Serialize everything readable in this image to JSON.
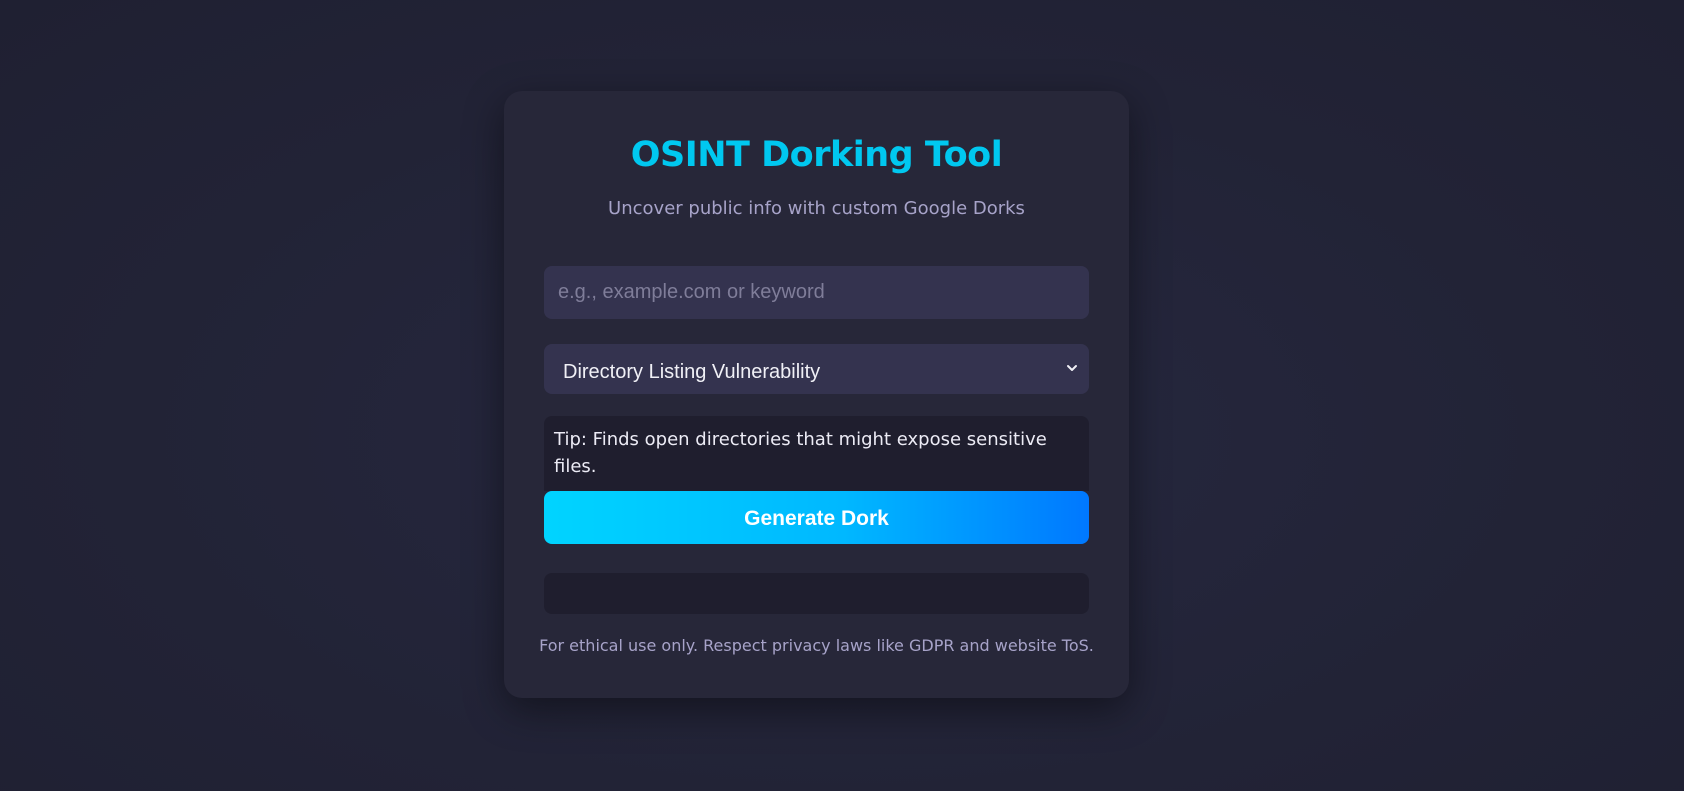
{
  "header": {
    "title": "OSINT Dorking Tool",
    "subtitle": "Uncover public info with custom Google Dorks"
  },
  "search": {
    "value": "",
    "placeholder": "e.g., example.com or keyword"
  },
  "dork_type": {
    "selected": "Directory Listing Vulnerability",
    "icon": "chevron-down-icon"
  },
  "tip": {
    "text": "Tip: Finds open directories that might expose sensitive files."
  },
  "actions": {
    "generate_label": "Generate Dork"
  },
  "output": {
    "text": ""
  },
  "footer": {
    "disclaimer": "For ethical use only. Respect privacy laws like GDPR and website ToS."
  },
  "colors": {
    "background": "#222336",
    "card": "#272739",
    "accent": "#00c8f0",
    "button_gradient_start": "#00d4ff",
    "button_gradient_end": "#0078ff",
    "input_background": "#34334f",
    "muted_text": "#a7a3c9"
  }
}
